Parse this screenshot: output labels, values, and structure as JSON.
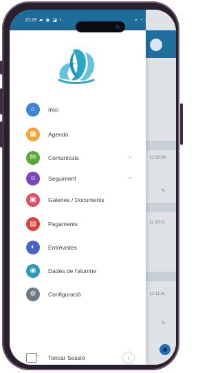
{
  "status_bar": {
    "time": "10:29",
    "left_icons": "▰ ◉ ◪ •",
    "right_icons": "▪ ◔ ▮ 88%"
  },
  "drawer": {
    "menu": [
      {
        "label": "Inici",
        "icon": "home-icon",
        "color": "#3b84d6",
        "glyph": "⌂"
      },
      {
        "label": "Agenda",
        "icon": "calendar-icon",
        "color": "#f2a33a",
        "glyph": "▦"
      },
      {
        "label": "Comunicats",
        "icon": "message-icon",
        "color": "#5aa83a",
        "glyph": "✉",
        "expandable": true
      },
      {
        "label": "Seguiment",
        "icon": "tracking-icon",
        "color": "#7a49b8",
        "glyph": "☺",
        "expandable": true
      },
      {
        "label": "Galeries / Documents",
        "icon": "gallery-icon",
        "color": "#d4536a",
        "glyph": "▣"
      },
      {
        "label": "Pagaments",
        "icon": "payment-icon",
        "color": "#d6453d",
        "glyph": "▤"
      },
      {
        "label": "Entrevistes",
        "icon": "interview-icon",
        "color": "#4b63c2",
        "glyph": "◐"
      },
      {
        "label": "Dades de l'alumne",
        "icon": "student-icon",
        "color": "#2e9ab8",
        "glyph": "◉"
      },
      {
        "label": "Configuració",
        "icon": "settings-icon",
        "color": "#6f7a84",
        "glyph": "⚙"
      }
    ],
    "logout_label": "Tancar Sessió",
    "collapse_glyph": "‹"
  },
  "background_app": {
    "times": [
      "11:18:54",
      "11:13:11",
      "11:11:01"
    ]
  },
  "colors": {
    "brand": "#1f6f9f",
    "logo_primary": "#2aa6c9",
    "logo_secondary": "#64c3dd"
  }
}
